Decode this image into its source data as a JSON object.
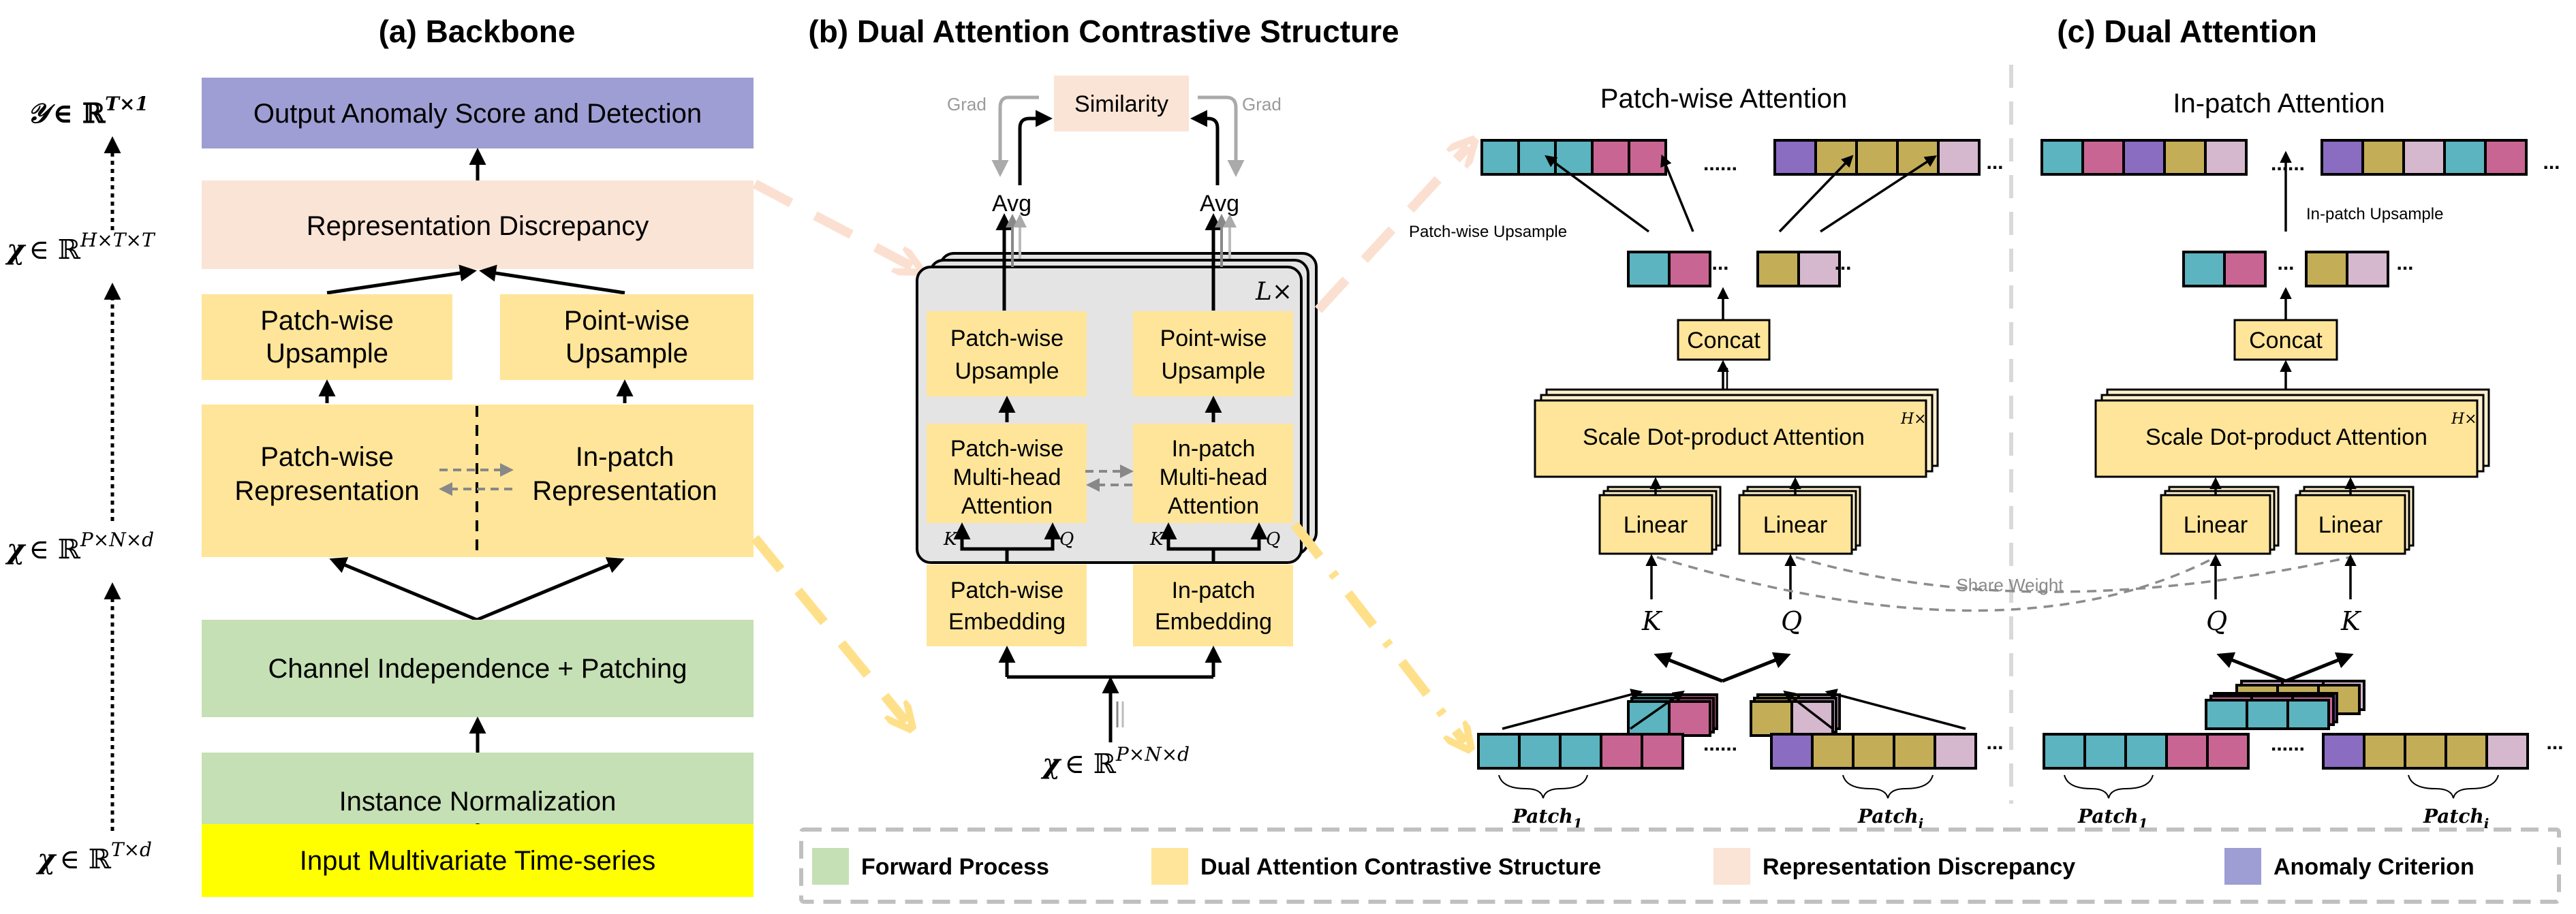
{
  "colors": {
    "anomaly_criterion": "#9e9ed4",
    "representation_discrepancy": "#fae4d6",
    "dual_attention": "#ffe599",
    "forward_process": "#c5e0b4",
    "input": "#ffff00",
    "block_grey": "#e4e4e4",
    "teal": "#5bb4bf",
    "pink": "#c96593",
    "purple": "#8a6cc1",
    "olive": "#c3ad57",
    "mauve": "#d5b8ce"
  },
  "panel_a": {
    "title": "(a) Backbone",
    "boxes": {
      "output": "Output Anomaly Score and Detection",
      "repr_discrepancy": "Representation Discrepancy",
      "patch_upsample_l1": "Patch-wise",
      "patch_upsample_l2": "Upsample",
      "point_upsample_l1": "Point-wise",
      "point_upsample_l2": "Upsample",
      "patch_repr_l1": "Patch-wise",
      "patch_repr_l2": "Representation",
      "inpatch_repr_l1": "In-patch",
      "inpatch_repr_l2": "Representation",
      "channel": "Channel Independence + Patching",
      "instance_norm": "Instance Normalization",
      "input": "Input Multivariate Time-series"
    },
    "dims": {
      "y_out": {
        "var": "𝒴",
        "set": "∈ ℝ",
        "sup": "T×1"
      },
      "x_htt": {
        "var": "χ",
        "set": "∈ ℝ",
        "sup": "H×T×T"
      },
      "x_pnd": {
        "var": "χ",
        "set": "∈ ℝ",
        "sup": "P×N×d"
      },
      "x_td": {
        "var": "χ",
        "set": "∈ ℝ",
        "sup": "T×d"
      }
    }
  },
  "panel_b": {
    "title": "(b) Dual Attention Contrastive Structure",
    "similarity": "Similarity",
    "grad_left": "Grad",
    "grad_right": "Grad",
    "avg_left": "Avg",
    "avg_right": "Avg",
    "layers": "L×",
    "boxes": {
      "patch_upsample_l1": "Patch-wise",
      "patch_upsample_l2": "Upsample",
      "point_upsample_l1": "Point-wise",
      "point_upsample_l2": "Upsample",
      "patch_mha_l1": "Patch-wise",
      "patch_mha_l2": "Multi-head",
      "patch_mha_l3": "Attention",
      "inpatch_mha_l1": "In-patch",
      "inpatch_mha_l2": "Multi-head",
      "inpatch_mha_l3": "Attention",
      "patch_emb_l1": "Patch-wise",
      "patch_emb_l2": "Embedding",
      "inpatch_emb_l1": "In-patch",
      "inpatch_emb_l2": "Embedding"
    },
    "k_label": "K",
    "q_label": "Q",
    "input_dim": {
      "var": "χ",
      "set": "∈ ℝ",
      "sup": "P×N×d"
    }
  },
  "panel_c": {
    "title": "(c) Dual Attention",
    "patchwise": {
      "title": "Patch-wise Attention",
      "upsample_label": "Patch-wise Upsample",
      "concat": "Concat",
      "sdpa": "Scale Dot-product Attention",
      "heads": "H×",
      "linear_left": "Linear",
      "linear_right": "Linear",
      "k_label": "K",
      "q_label": "Q",
      "patch1": "Patch",
      "patch1_sub": "1",
      "patchi": "Patch",
      "patchi_sub": "i",
      "ellipsis_long": "......",
      "ellipsis_short": "..."
    },
    "inpatch": {
      "title": "In-patch Attention",
      "upsample_label": "In-patch Upsample",
      "concat": "Concat",
      "sdpa": "Scale Dot-product Attention",
      "heads": "H×",
      "linear_left": "Linear",
      "linear_right": "Linear",
      "q_label": "Q",
      "k_label": "K",
      "patch1": "Patch",
      "patch1_sub": "1",
      "patchi": "Patch",
      "patchi_sub": "i",
      "ellipsis_long": "......",
      "ellipsis_short": "..."
    },
    "share_weight": "Share Weight"
  },
  "legend": {
    "items": [
      {
        "label": "Forward Process",
        "color": "#c5e0b4"
      },
      {
        "label": "Dual Attention Contrastive Structure",
        "color": "#ffe599"
      },
      {
        "label": "Representation Discrepancy",
        "color": "#fae4d6"
      },
      {
        "label": "Anomaly Criterion",
        "color": "#9e9ed4"
      }
    ]
  }
}
